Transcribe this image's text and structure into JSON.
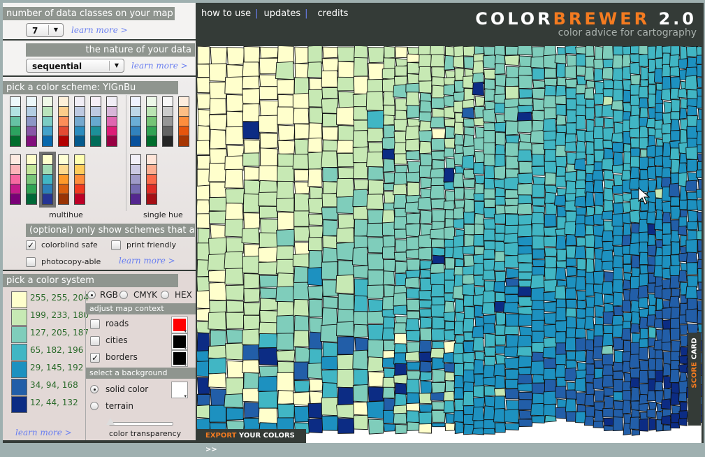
{
  "nav": {
    "items": [
      "how to use",
      "updates",
      "credits"
    ]
  },
  "logo": {
    "part1": "COLOR",
    "part2": "BREWER",
    "version": "2.0",
    "subtitle": "color advice for cartography"
  },
  "classes": {
    "header": "number of data classes on your map",
    "value": "7",
    "learn_more": "learn more >"
  },
  "nature": {
    "header": "the nature of your data",
    "value": "sequential",
    "learn_more": "learn more >"
  },
  "scheme": {
    "header": "pick a color scheme: YlGnBu",
    "selected": "YlGnBu",
    "multihue_label": "multihue",
    "singlehue_label": "single hue",
    "multihue_row1": [
      [
        "#edf8fb",
        "#b2e2e2",
        "#66c2a4",
        "#2ca25f",
        "#006d2c"
      ],
      [
        "#edf8fb",
        "#b3cde3",
        "#8c96c6",
        "#8856a7",
        "#810f7c"
      ],
      [
        "#f0f9e8",
        "#bae4bc",
        "#7bccc4",
        "#43a2ca",
        "#0868ac"
      ],
      [
        "#fef0d9",
        "#fdcc8a",
        "#fc8d59",
        "#e34a33",
        "#b30000"
      ],
      [
        "#f1eef6",
        "#bdc9e1",
        "#74a9cf",
        "#2b8cbe",
        "#045a8d"
      ],
      [
        "#f6eff7",
        "#bdc9e1",
        "#67a9cf",
        "#1c9099",
        "#016c59"
      ],
      [
        "#f1eef6",
        "#d7b5d8",
        "#df65b0",
        "#dd1c77",
        "#980043"
      ]
    ],
    "multihue_row2": [
      [
        "#feebe2",
        "#fbb4b9",
        "#f768a1",
        "#c51b8a",
        "#7a0177"
      ],
      [
        "#ffffcc",
        "#c2e699",
        "#78c679",
        "#31a354",
        "#006837"
      ],
      [
        "#ffffcc",
        "#a1dab4",
        "#41b6c4",
        "#2c7fb8",
        "#253494"
      ],
      [
        "#ffffd4",
        "#fed98e",
        "#fe9929",
        "#d95f0e",
        "#993404"
      ],
      [
        "#ffffb2",
        "#fecc5c",
        "#fd8d3c",
        "#f03b20",
        "#bd0026"
      ]
    ],
    "singlehue_row1": [
      [
        "#eff3ff",
        "#bdd7e7",
        "#6baed6",
        "#3182bd",
        "#08519c"
      ],
      [
        "#edf8e9",
        "#bae4b3",
        "#74c476",
        "#31a354",
        "#006d2c"
      ],
      [
        "#f7f7f7",
        "#cccccc",
        "#969696",
        "#636363",
        "#252525"
      ],
      [
        "#feedde",
        "#fdbe85",
        "#fd8d3c",
        "#e6550d",
        "#a63603"
      ]
    ],
    "singlehue_row2": [
      [
        "#f2f0f7",
        "#cbc9e2",
        "#9e9ac8",
        "#756bb1",
        "#54278f"
      ],
      [
        "#fee5d9",
        "#fcae91",
        "#fb6a4a",
        "#de2d26",
        "#a50f15"
      ]
    ]
  },
  "filters": {
    "header": "(optional) only show schemes that are:",
    "colorblind": {
      "label": "colorblind safe",
      "checked": true
    },
    "print": {
      "label": "print friendly",
      "checked": false
    },
    "photocopy": {
      "label": "photocopy-able",
      "checked": false
    },
    "learn_more": "learn more >"
  },
  "color_system": {
    "header": "pick a color system",
    "options": [
      "RGB",
      "CMYK",
      "HEX"
    ],
    "selected": "RGB",
    "colors": [
      {
        "rgb": "255, 255, 204",
        "hex": "#ffffcc"
      },
      {
        "rgb": "199, 233, 180",
        "hex": "#c7e9b4"
      },
      {
        "rgb": "127, 205, 187",
        "hex": "#7fcdbb"
      },
      {
        "rgb": "65, 182, 196",
        "hex": "#41b6c4"
      },
      {
        "rgb": "29, 145, 192",
        "hex": "#1d91c0"
      },
      {
        "rgb": "34, 94, 168",
        "hex": "#225ea8"
      },
      {
        "rgb": "12, 44, 132",
        "hex": "#0c2c84"
      }
    ],
    "learn_more": "learn more >"
  },
  "map_context": {
    "header": "adjust map context",
    "roads": {
      "label": "roads",
      "checked": false,
      "color": "#ff0000"
    },
    "cities": {
      "label": "cities",
      "checked": false,
      "color": "#000000"
    },
    "borders": {
      "label": "borders",
      "checked": true,
      "color": "#000000"
    }
  },
  "background": {
    "header": "select a background",
    "solid": {
      "label": "solid color",
      "selected": true,
      "color": "#ffffff"
    },
    "terrain": {
      "label": "terrain",
      "selected": false
    },
    "transparency_label": "color transparency",
    "transparency": 0
  },
  "export": {
    "part1": "EXPORT",
    "part2": "YOUR COLORS >>"
  },
  "scorecard": {
    "part1": "SCORE",
    "part2": "CARD"
  }
}
